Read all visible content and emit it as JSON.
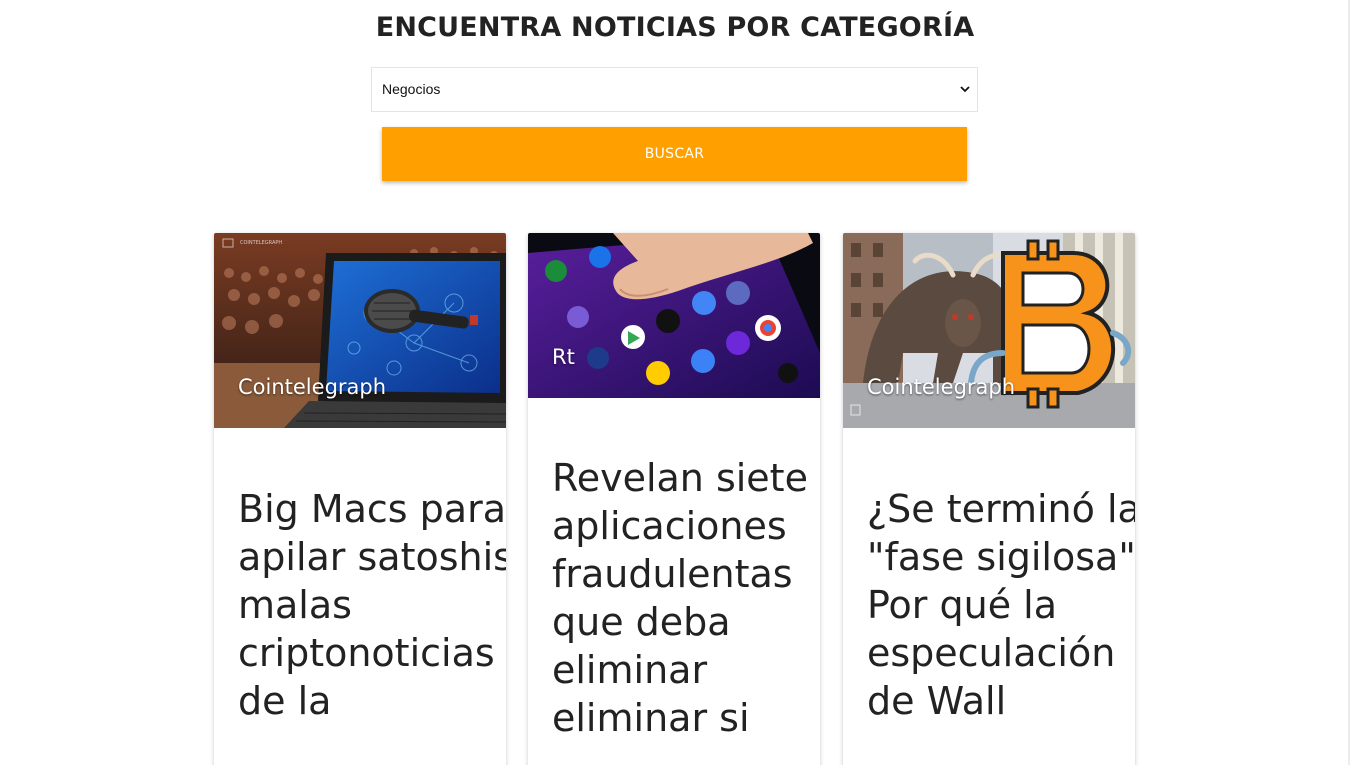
{
  "page": {
    "title": "ENCUENTRA NOTICIAS POR CATEGORÍA"
  },
  "search": {
    "category_selected": "Negocios",
    "button_label": "BUSCAR"
  },
  "colors": {
    "accent": "#ffa000",
    "title": "#222222",
    "card_text": "#222222"
  },
  "cards": [
    {
      "source": "Cointelegraph",
      "headline": "Big Macs para apilar satoshis: malas criptonoticias de la",
      "image_subject": "laptop with microphone at conference",
      "image_watermark": "COINTELEGRAPH"
    },
    {
      "source": "Rt",
      "headline": "Revelan siete aplicaciones fraudulentas que deba eliminar eliminar si",
      "image_subject": "finger touching smartphone app screen"
    },
    {
      "source": "Cointelegraph",
      "headline": "¿Se terminó la \"fase sigilosa\"? Por qué la especulación de Wall",
      "image_subject": "wall street bull with bitcoin symbol"
    }
  ]
}
